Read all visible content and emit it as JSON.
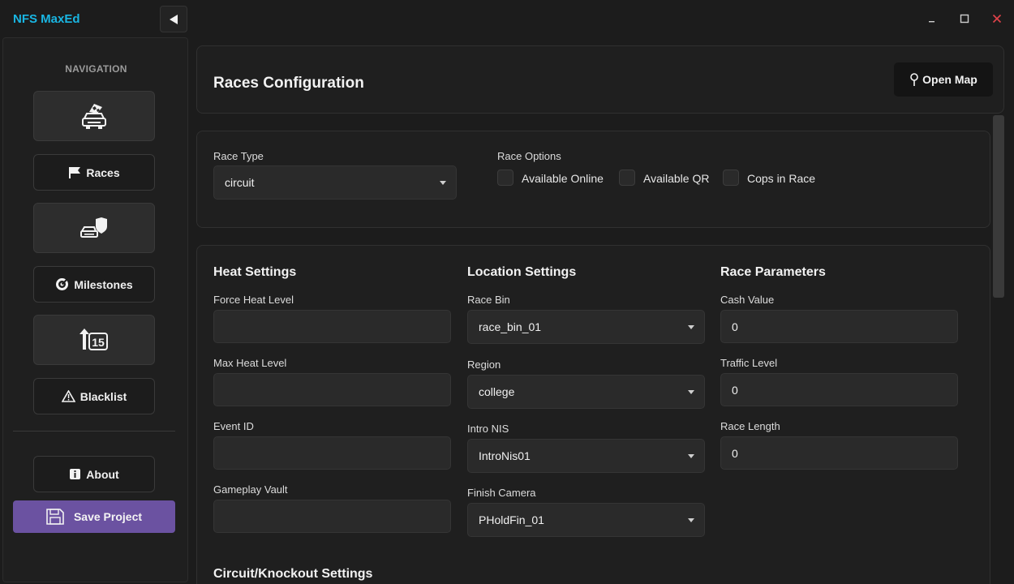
{
  "app": {
    "title": "NFS MaxEd"
  },
  "titlebar": {
    "back_icon": "back-arrow-icon",
    "minimize": "minimize-icon",
    "maximize": "maximize-icon",
    "close": "close-icon"
  },
  "sidebar": {
    "heading": "NAVIGATION",
    "items": [
      {
        "icon": "car-checkered-flag-icon",
        "label": ""
      },
      {
        "icon": "flag-icon",
        "label": "Races"
      },
      {
        "icon": "police-car-badge-icon",
        "label": ""
      },
      {
        "icon": "target-icon",
        "label": "Milestones"
      },
      {
        "icon": "rank-15-up-icon",
        "label": ""
      },
      {
        "icon": "warning-icon",
        "label": "Blacklist"
      },
      {
        "icon": "info-icon",
        "label": "About"
      }
    ],
    "save_label": "Save Project",
    "save_icon": "floppy-disk-icon"
  },
  "header": {
    "title": "Races Configuration",
    "open_map_label": "Open Map",
    "open_map_icon": "map-pin-icon"
  },
  "race_type": {
    "label": "Race Type",
    "value": "circuit"
  },
  "race_options": {
    "label": "Race Options",
    "checkboxes": [
      {
        "label": "Available Online",
        "checked": false
      },
      {
        "label": "Available QR",
        "checked": false
      },
      {
        "label": "Cops in Race",
        "checked": false
      }
    ]
  },
  "heat": {
    "title": "Heat Settings",
    "fields": [
      {
        "label": "Force Heat Level",
        "value": ""
      },
      {
        "label": "Max Heat Level",
        "value": ""
      },
      {
        "label": "Event ID",
        "value": ""
      },
      {
        "label": "Gameplay Vault",
        "value": ""
      }
    ]
  },
  "location": {
    "title": "Location Settings",
    "fields": [
      {
        "label": "Race Bin",
        "value": "race_bin_01"
      },
      {
        "label": "Region",
        "value": "college"
      },
      {
        "label": "Intro NIS",
        "value": "IntroNis01"
      },
      {
        "label": "Finish Camera",
        "value": "PHoldFin_01"
      }
    ]
  },
  "params": {
    "title": "Race Parameters",
    "fields": [
      {
        "label": "Cash Value",
        "value": "0"
      },
      {
        "label": "Traffic Level",
        "value": "0"
      },
      {
        "label": "Race Length",
        "value": "0"
      }
    ]
  },
  "circuit_section_title": "Circuit/Knockout Settings",
  "colors": {
    "accent": "#19b6e3",
    "save_button": "#6b52a1",
    "close": "#e0424a"
  }
}
